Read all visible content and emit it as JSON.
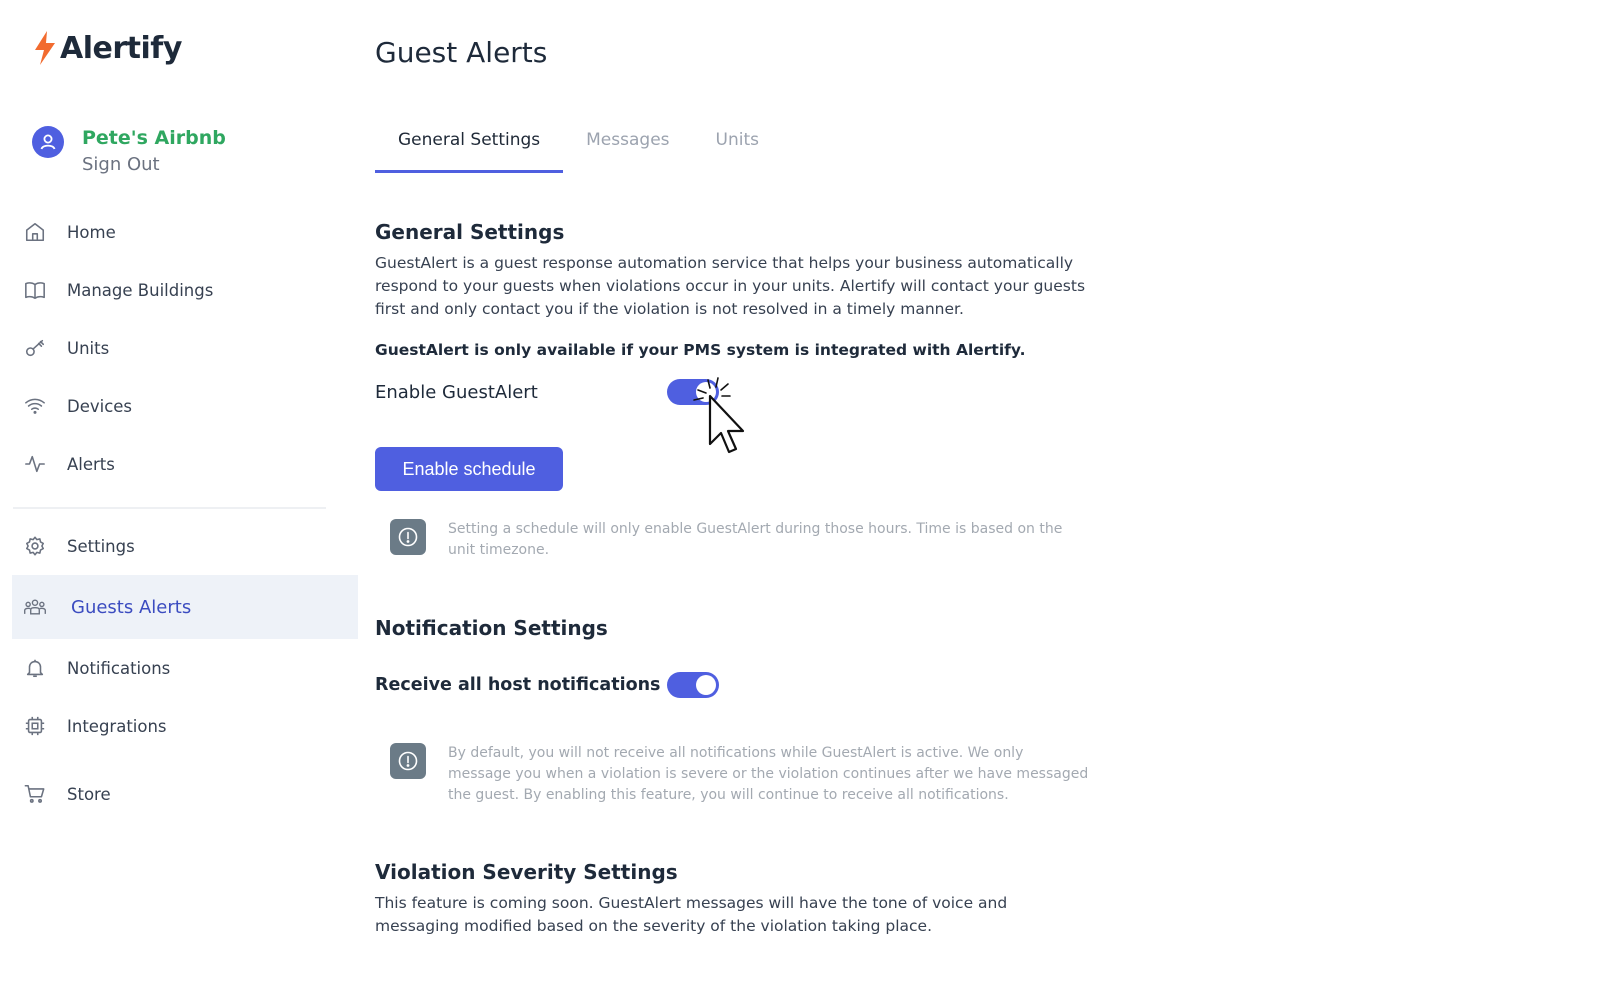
{
  "brand": {
    "name": "Alertify",
    "accent": "#f26b2f"
  },
  "account": {
    "name": "Pete's Airbnb",
    "sign_out": "Sign Out"
  },
  "nav": {
    "primary": [
      {
        "label": "Home",
        "icon": "home-icon"
      },
      {
        "label": "Manage Buildings",
        "icon": "book-icon"
      },
      {
        "label": "Units",
        "icon": "key-icon"
      },
      {
        "label": "Devices",
        "icon": "wifi-icon"
      },
      {
        "label": "Alerts",
        "icon": "activity-icon"
      }
    ],
    "secondary": [
      {
        "label": "Settings",
        "icon": "gear-icon"
      },
      {
        "label": "Guests Alerts",
        "icon": "users-icon",
        "active": true
      },
      {
        "label": "Notifications",
        "icon": "bell-icon"
      },
      {
        "label": "Integrations",
        "icon": "chip-icon"
      },
      {
        "label": "Store",
        "icon": "cart-icon"
      }
    ]
  },
  "page": {
    "title": "Guest Alerts"
  },
  "tabs": [
    {
      "label": "General Settings",
      "active": true
    },
    {
      "label": "Messages"
    },
    {
      "label": "Units"
    }
  ],
  "general": {
    "heading": "General Settings",
    "description": "GuestAlert is a guest response automation service that helps your business automatically respond to your guests when violations occur in your units. Alertify will contact your guests first and only contact you if the violation is not resolved in a timely manner.",
    "pms_note": "GuestAlert is only available if your PMS system is integrated with Alertify.",
    "enable_label": "Enable GuestAlert",
    "enable_on": true,
    "schedule_button": "Enable schedule",
    "schedule_info": "Setting a schedule will only enable GuestAlert during those hours. Time is based on the unit timezone."
  },
  "notification": {
    "heading": "Notification Settings",
    "receive_label": "Receive all host notifications",
    "receive_on": true,
    "info": "By default, you will not receive all notifications while GuestAlert is active. We only message you when a violation is severe or the violation continues after we have messaged the guest. By enabling this feature, you will continue to receive all notifications."
  },
  "severity": {
    "heading": "Violation Severity Settings",
    "description": "This feature is coming soon. GuestAlert messages will have the tone of voice and messaging modified based on the severity of the violation taking place."
  },
  "colors": {
    "primary": "#4f5fe0",
    "account_name": "#2fa760",
    "active_nav_bg": "#eef2f8"
  }
}
